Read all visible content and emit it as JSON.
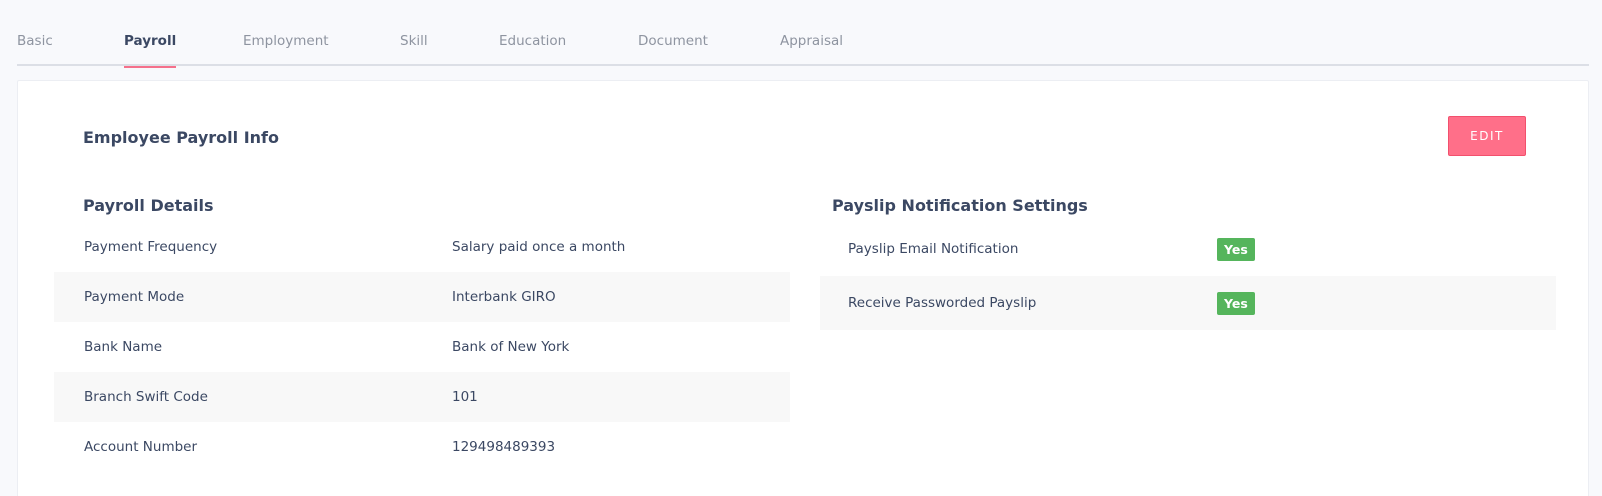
{
  "tabs": [
    {
      "label": "Basic"
    },
    {
      "label": "Payroll"
    },
    {
      "label": "Employment"
    },
    {
      "label": "Skill"
    },
    {
      "label": "Education"
    },
    {
      "label": "Document"
    },
    {
      "label": "Appraisal"
    }
  ],
  "active_tab": "Payroll",
  "card": {
    "title": "Employee Payroll Info",
    "edit_label": "EDIT"
  },
  "payroll_details": {
    "title": "Payroll Details",
    "rows": [
      {
        "label": "Payment Frequency",
        "value": "Salary paid once a month"
      },
      {
        "label": "Payment Mode",
        "value": "Interbank GIRO"
      },
      {
        "label": "Bank Name",
        "value": "Bank of New York"
      },
      {
        "label": "Branch Swift Code",
        "value": "101"
      },
      {
        "label": "Account Number",
        "value": "129498489393"
      }
    ]
  },
  "payslip_settings": {
    "title": "Payslip Notification Settings",
    "rows": [
      {
        "label": "Payslip Email Notification",
        "value": "Yes"
      },
      {
        "label": "Receive Passworded Payslip",
        "value": "Yes"
      }
    ]
  },
  "colors": {
    "accent": "#ff6f89",
    "badge_green": "#55b55c"
  }
}
